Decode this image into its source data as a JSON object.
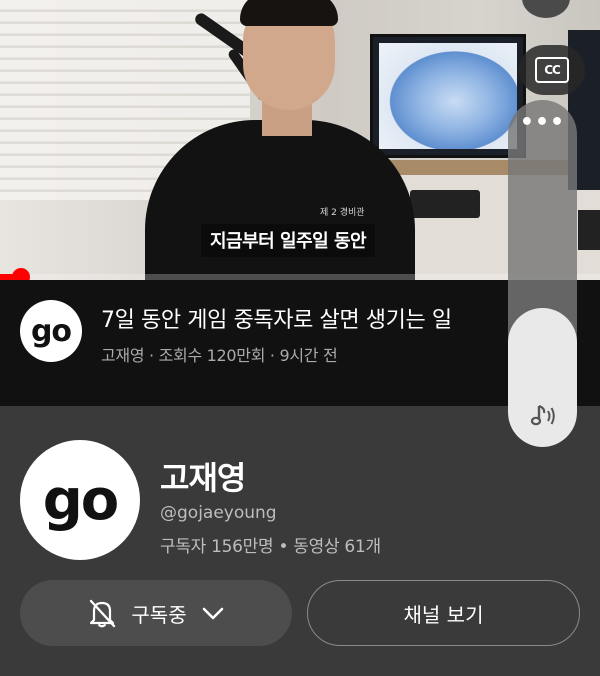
{
  "player": {
    "caption": "지금부터 일주일 동안",
    "shirt_print": "제 2 경비관",
    "progress_fraction": 0.035,
    "progress_color": "#ff0000",
    "cc_label": "CC",
    "cc_icon": "closed-captions-icon",
    "top_button_icon": "close-icon"
  },
  "video": {
    "avatar_text": "go",
    "title": "7일 동안 게임 중독자로 살면 생기는 일",
    "meta": "고재영 · 조회수 120만회 · 9시간 전"
  },
  "volume": {
    "level_fraction": 0.4,
    "menu_icon": "more-dots-icon",
    "menu_text": "•••",
    "icon": "music-volume-icon"
  },
  "channel": {
    "avatar_text": "go",
    "name": "고재영",
    "handle": "@gojaeyoung",
    "stats": "구독자 156만명 • 동영상 61개",
    "subscribed_label": "구독중",
    "bell_icon": "bell-off-icon",
    "chevron_icon": "chevron-down-icon",
    "view_channel_label": "채널 보기"
  },
  "colors": {
    "background": "#3a3a3a",
    "info_strip": "#111111",
    "accent_red": "#ff0000",
    "button_fill": "#4d4d4d"
  }
}
